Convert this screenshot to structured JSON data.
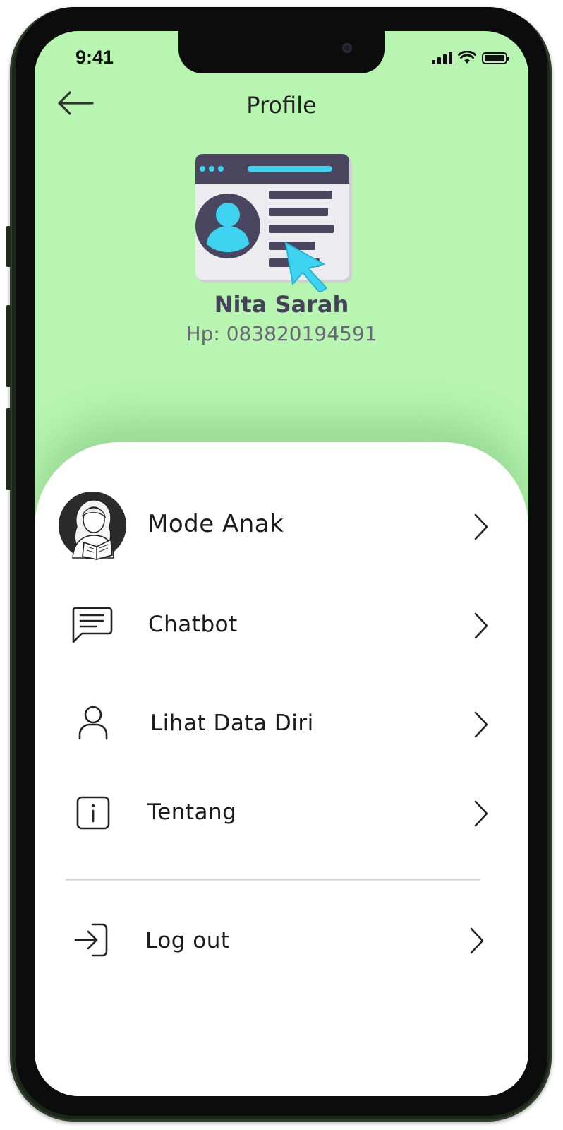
{
  "status_bar": {
    "time": "9:41"
  },
  "header": {
    "title": "Profile"
  },
  "profile": {
    "name": "Nita Sarah",
    "phone": "Hp: 083820194591"
  },
  "menu": [
    {
      "label": "Mode Anak",
      "icon": "child-reading-avatar-icon"
    },
    {
      "label": "Chatbot",
      "icon": "chat-bubble-icon"
    },
    {
      "label": "Lihat Data Diri",
      "icon": "person-icon"
    },
    {
      "label": "Tentang",
      "icon": "info-icon"
    }
  ],
  "logout": {
    "label": "Log out",
    "icon": "logout-icon"
  },
  "colors": {
    "header_bg": "#b7f5b0",
    "name_text": "#45405c",
    "accent": "#2cc9ec"
  }
}
